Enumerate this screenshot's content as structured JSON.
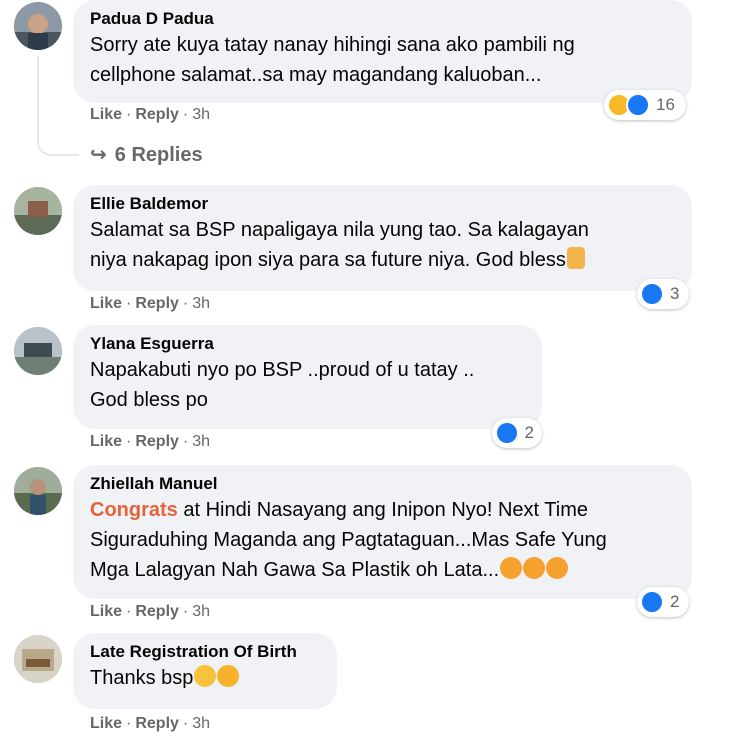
{
  "actions": {
    "like": "Like",
    "reply": "Reply",
    "separator": "·"
  },
  "comments": [
    {
      "author": "Padua D Padua",
      "text": "Sorry ate kuya tatay nanay hihingi sana ako pambili ng\ncellphone salamat..sa may magandang kaluoban...",
      "time": "3h",
      "reactions": {
        "icons": [
          "haha-icon",
          "like-icon"
        ],
        "count": "16"
      },
      "replies": "6 Replies"
    },
    {
      "author": "Ellie Baldemor",
      "text": "Salamat sa BSP napaligaya nila yung tao. Sa kalagayan\nniya nakapag ipon siya para sa future niya. God bless",
      "time": "3h",
      "reactions": {
        "icons": [
          "like-icon"
        ],
        "count": "3"
      }
    },
    {
      "author": "Ylana Esguerra",
      "text": "Napakabuti nyo po BSP ..proud of u tatay ..\nGod bless po",
      "time": "3h",
      "reactions": {
        "icons": [
          "like-icon"
        ],
        "count": "2"
      }
    },
    {
      "author": "Zhiellah Manuel",
      "highlight": "Congrats",
      "text": " at Hindi Nasayang ang Inipon Nyo! Next Time\nSiguraduhing Maganda ang Pagtataguan...Mas Safe Yung\nMga Lalagyan Nah Gawa Sa Plastik oh Lata...",
      "time": "3h",
      "reactions": {
        "icons": [
          "like-icon"
        ],
        "count": "2"
      }
    },
    {
      "author": "Late Registration Of Birth",
      "text": "Thanks bsp",
      "time": "3h"
    }
  ],
  "colors": {
    "like_blue": "#1877f2",
    "highlight": "#e4633b",
    "bubble": "#f0f2f5",
    "meta": "#65676b"
  }
}
